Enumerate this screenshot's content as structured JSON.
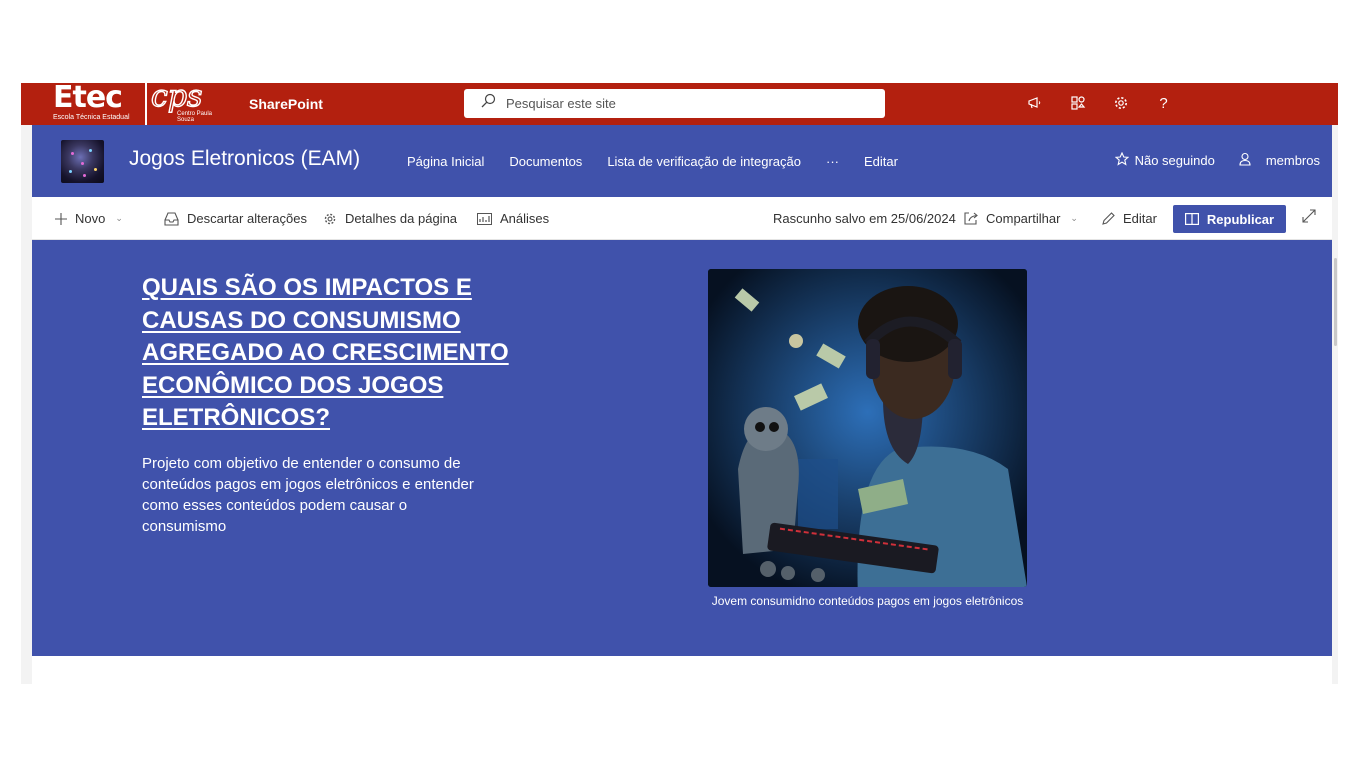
{
  "suitebar": {
    "logo_text": "Etec",
    "logo_subtitle": "Escola Técnica Estadual",
    "partner_logo_text": "cps",
    "partner_logo_subtitle": "Centro Paula Souza",
    "app_name": "SharePoint",
    "search_placeholder": "Pesquisar este site",
    "icons": [
      "megaphone-icon",
      "app-switch-icon",
      "settings-gear-icon",
      "help-icon"
    ],
    "help_glyph": "?"
  },
  "site": {
    "title": "Jogos Eletronicos (EAM)",
    "nav": [
      "Página Inicial",
      "Documentos",
      "Lista de verificação de integração",
      "···",
      "Editar"
    ],
    "follow_label": "Não seguindo",
    "members_label": "membros"
  },
  "commandbar": {
    "new_label": "Novo",
    "discard_label": "Descartar alterações",
    "page_details_label": "Detalhes da página",
    "analytics_label": "Análises",
    "draft_status": "Rascunho salvo em 25/06/2024",
    "share_label": "Compartilhar",
    "edit_label": "Editar",
    "republish_label": "Republicar"
  },
  "hero": {
    "title": "QUAIS SÃO OS IMPACTOS E CAUSAS DO CONSUMISMO AGREGADO AO CRESCIMENTO ECONÔMICO DOS JOGOS ELETRÔNICOS? ",
    "description": "Projeto  com objetivo de entender o consumo de conteúdos pagos em jogos eletrônicos e entender como esses conteúdos podem causar o consumismo",
    "image_caption": "Jovem consumidno conteúdos pagos em jogos eletrônicos"
  },
  "colors": {
    "suitebar": "#b3200f",
    "theme": "#4052ab"
  }
}
